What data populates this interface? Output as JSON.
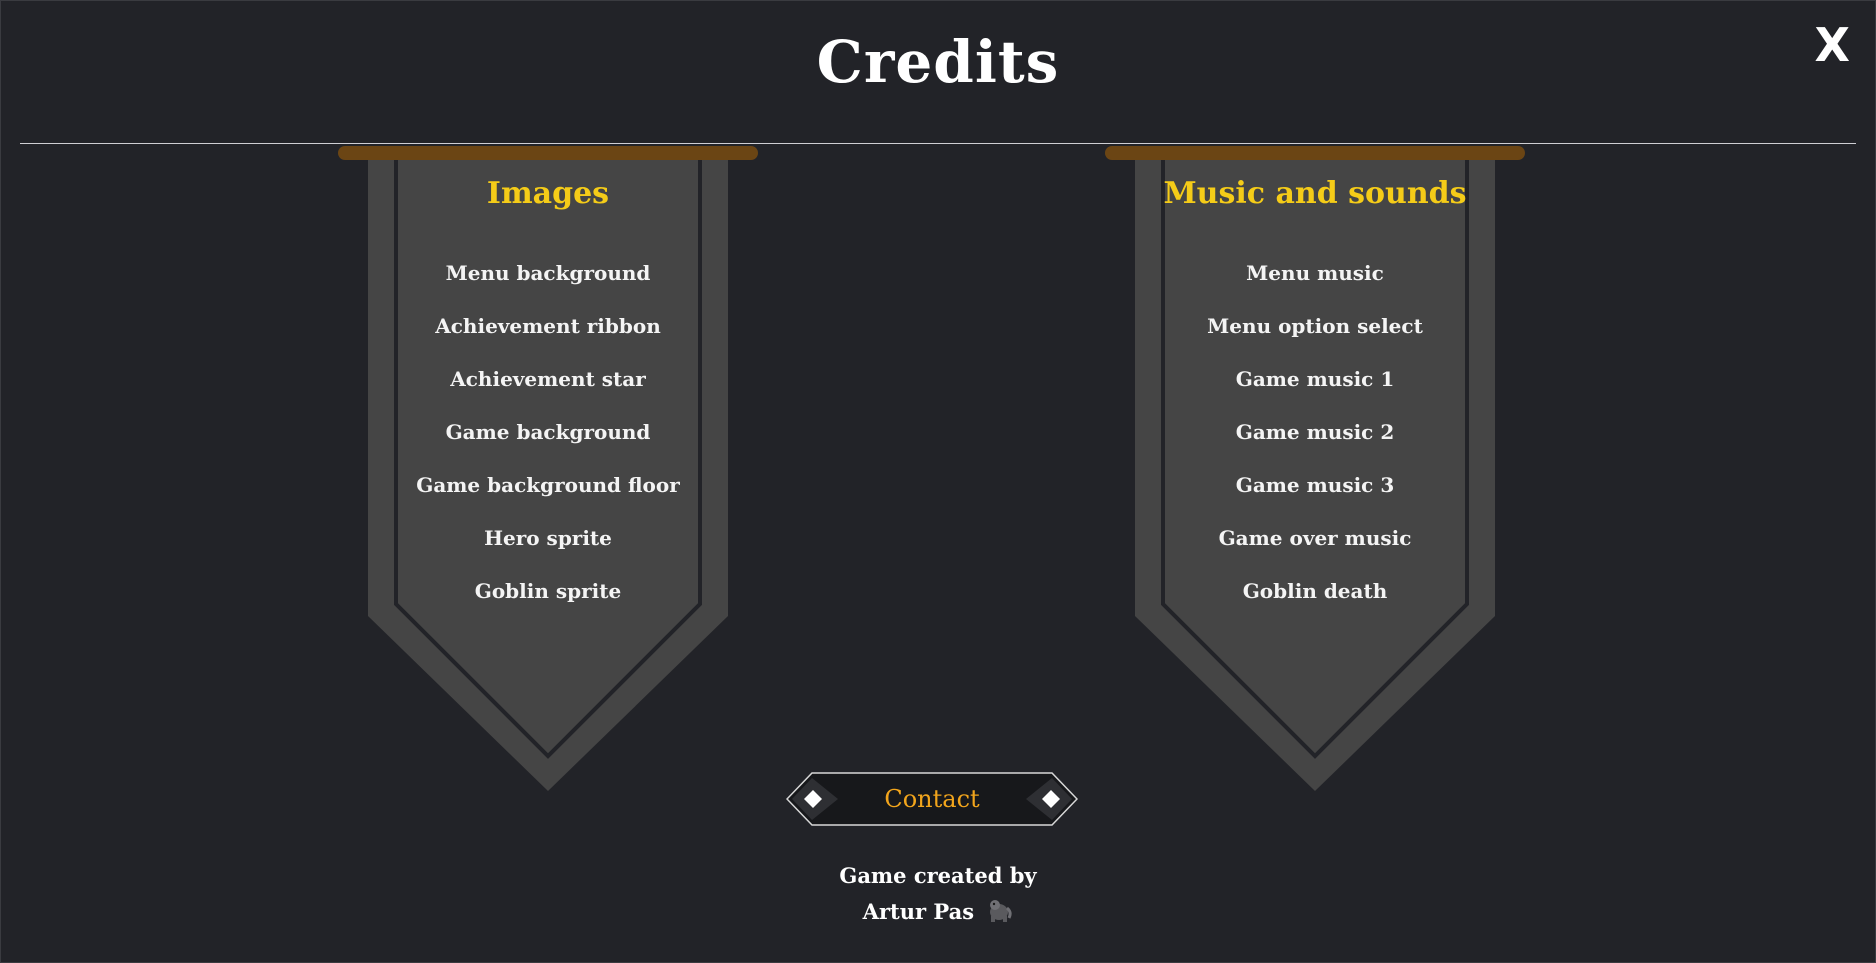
{
  "header": {
    "title": "Credits",
    "close_label": "X"
  },
  "images_banner": {
    "title": "Images",
    "items": [
      "Menu background",
      "Achievement ribbon",
      "Achievement star",
      "Game background",
      "Game background floor",
      "Hero sprite",
      "Goblin sprite"
    ]
  },
  "music_banner": {
    "title": "Music and sounds",
    "items": [
      "Menu music",
      "Menu option select",
      "Game music 1",
      "Game music 2",
      "Game music 3",
      "Game over music",
      "Goblin death"
    ]
  },
  "contact": {
    "label": "Contact"
  },
  "footer": {
    "line1": "Game created by",
    "line2": "Artur Pas",
    "icon": "gorilla-icon"
  },
  "colors": {
    "background": "#222328",
    "banner_fill": "#454545",
    "banner_inner_border": "#222328",
    "rod": "#6b4514",
    "banner_title": "#f5cc18",
    "contact_text": "#f2a51c",
    "text": "#ffffff"
  }
}
